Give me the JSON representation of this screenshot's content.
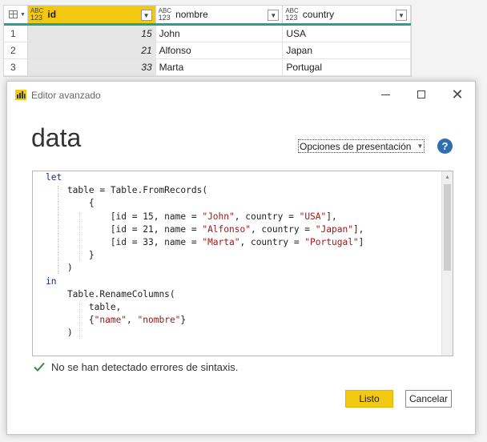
{
  "grid": {
    "columns": [
      {
        "name": "id",
        "type_top": "ABC",
        "type_bottom": "123",
        "selected": true
      },
      {
        "name": "nombre",
        "type_top": "ABC",
        "type_bottom": "123",
        "selected": false
      },
      {
        "name": "country",
        "type_top": "ABC",
        "type_bottom": "123",
        "selected": false
      }
    ],
    "rows": [
      {
        "num": "1",
        "id": "15",
        "nombre": "John",
        "country": "USA"
      },
      {
        "num": "2",
        "id": "21",
        "nombre": "Alfonso",
        "country": "Japan"
      },
      {
        "num": "3",
        "id": "33",
        "nombre": "Marta",
        "country": "Portugal"
      }
    ],
    "accent_color": "#1fa38a",
    "selected_header_color": "#f2c811"
  },
  "dialog": {
    "title": "Editor avanzado",
    "query_name": "data",
    "display_options_label": "Opciones de presentación",
    "help_label": "?",
    "status_text": "No se han detectado errores de sintaxis.",
    "status_icon": "check-icon",
    "done_label": "Listo",
    "cancel_label": "Cancelar",
    "done_color": "#f2c811"
  },
  "code_lines": [
    "let",
    "    table = Table.FromRecords(",
    "        {",
    "            [id = 15, name = \"John\", country = \"USA\"],",
    "            [id = 21, name = \"Alfonso\", country = \"Japan\"],",
    "            [id = 33, name = \"Marta\", country = \"Portugal\"]",
    "        }",
    "    )",
    "in",
    "    Table.RenameColumns(",
    "        table,",
    "        {\"name\", \"nombre\"}",
    "    )"
  ]
}
